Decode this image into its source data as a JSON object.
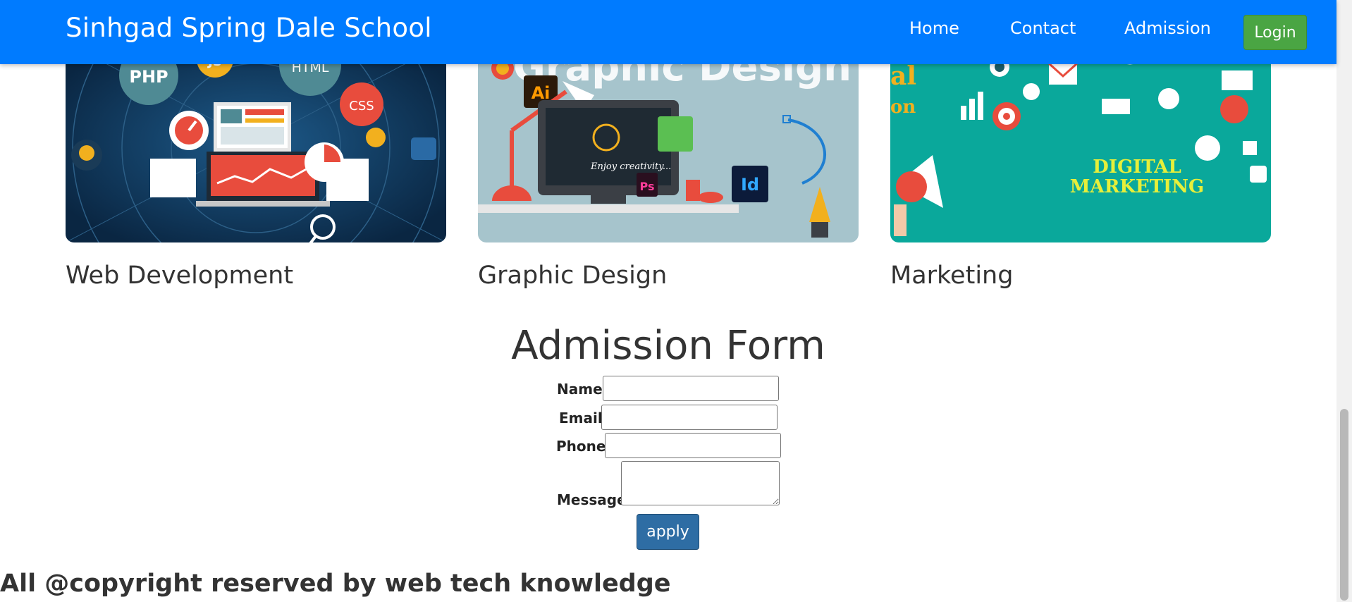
{
  "brand": "Sinhgad Spring Dale School",
  "nav": {
    "home": "Home",
    "contact": "Contact",
    "admission": "Admission",
    "login": "Login"
  },
  "cards": [
    {
      "title": "Web Development",
      "image_labels": [
        "PHP",
        "JS",
        "HTML",
        "CSS"
      ]
    },
    {
      "title": "Graphic Design",
      "image_labels": [
        "Graphic Design",
        "Ai",
        "Ps",
        "Id",
        "Enjoy creativity..."
      ]
    },
    {
      "title": "Marketing",
      "image_labels": [
        "al",
        "on",
        "DIGITAL",
        "MARKETING"
      ]
    }
  ],
  "form": {
    "title": "Admission Form",
    "name_label": "Name",
    "email_label": "Email",
    "phone_label": "Phone",
    "message_label": "Message",
    "name_value": "",
    "email_value": "",
    "phone_value": "",
    "message_value": "",
    "submit_label": "apply"
  },
  "footer": "All @copyright reserved by web tech knowledge",
  "colors": {
    "navbar": "#007bff",
    "login": "#4aa543",
    "apply": "#2e6da4",
    "web_bg": "#0d2f4f",
    "design_bg": "#a6c4cc",
    "marketing_bg": "#0aa89b"
  }
}
